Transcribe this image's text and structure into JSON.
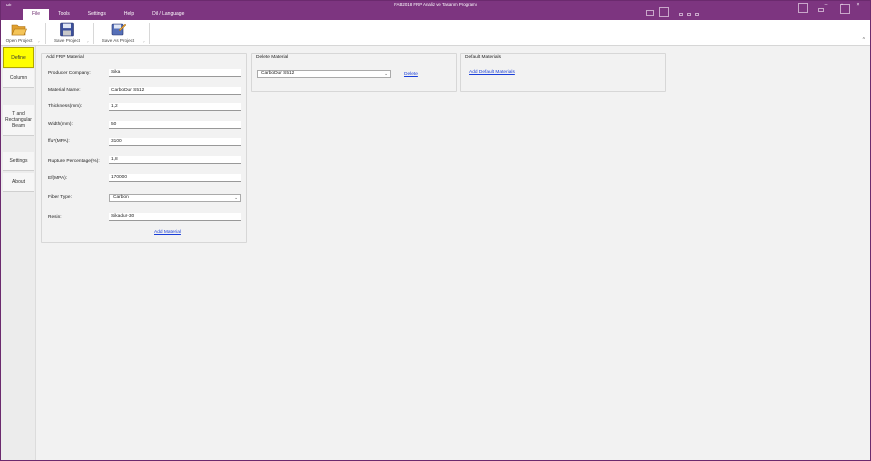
{
  "window": {
    "app_icon_label": "ωb",
    "title": "FAB2018 FRP Analiz ve Tasarım Programı"
  },
  "tabs": [
    "File",
    "Tools",
    "Settings",
    "Help",
    "Dil / Language"
  ],
  "active_tab": "File",
  "ribbon": {
    "open_label": "Open Project",
    "save_label": "Save Project",
    "save_as_label": "Save As Project"
  },
  "sidebar": {
    "items": [
      "Define",
      "Column",
      "T and Rectangular Beam",
      "Settings",
      "About"
    ],
    "active": "Define"
  },
  "add_frp": {
    "title": "Add FRP Material",
    "fields": [
      {
        "label": "Producer Company:",
        "value": "Sika"
      },
      {
        "label": "Material Name:",
        "value": "CarboDur S512"
      },
      {
        "label": "Thickness(mm):",
        "value": "1,2"
      },
      {
        "label": "Width(mm):",
        "value": "50"
      },
      {
        "label": "ffu*(MPA):",
        "value": "3100"
      },
      {
        "label": "Rupture Percentage(%):",
        "value": "1,8"
      },
      {
        "label": "Ef(MPA):",
        "value": "170000"
      }
    ],
    "fiber_type_label": "Fiber Type:",
    "fiber_type_value": "Carbon",
    "resin_label": "Resin:",
    "resin_value": "Sikadur-30",
    "add_link": "Add Material"
  },
  "delete_material": {
    "title": "Delete Material",
    "selected": "CarboDur S512",
    "delete_link": "Delete"
  },
  "default_materials": {
    "title": "Default Materials",
    "add_link": "Add Default Materials"
  },
  "colors": {
    "title_bar": "#7d3580",
    "active_sidebar": "#ffff00",
    "link": "#1a3fd8"
  }
}
